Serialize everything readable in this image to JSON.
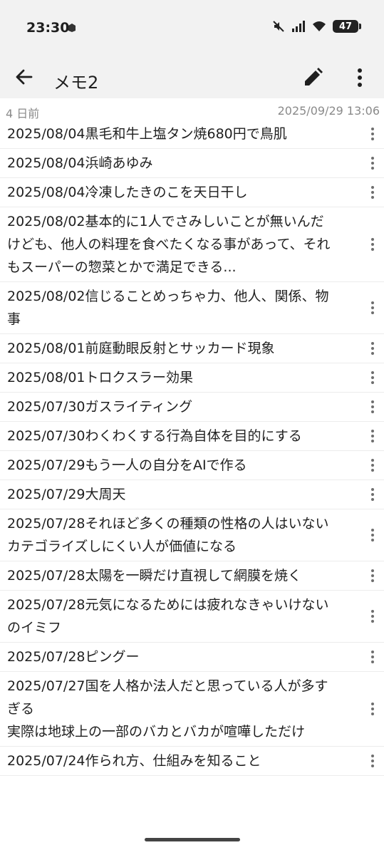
{
  "status": {
    "time": "23:30",
    "battery": "47"
  },
  "appbar": {
    "title": "メモ2"
  },
  "meta": {
    "relative": "4 日前",
    "timestamp": "2025/09/29 13:06"
  },
  "items": [
    {
      "text": "2025/08/04黒毛和牛上塩タン焼680円で鳥肌"
    },
    {
      "text": "2025/08/04浜崎あゆみ"
    },
    {
      "text": "2025/08/04冷凍したきのこを天日干し"
    },
    {
      "text": "2025/08/02基本的に1人でさみしいことが無いんだけども、他人の料理を食べたくなる事があって、それもスーパーの惣菜とかで満足できる..."
    },
    {
      "text": "2025/08/02信じることめっちゃ力、他人、関係、物事"
    },
    {
      "text": "2025/08/01前庭動眼反射とサッカード現象"
    },
    {
      "text": "2025/08/01トロクスラー効果"
    },
    {
      "text": "2025/07/30ガスライティング"
    },
    {
      "text": "2025/07/30わくわくする行為自体を目的にする"
    },
    {
      "text": "2025/07/29もう一人の自分をAIで作る"
    },
    {
      "text": "2025/07/29大周天"
    },
    {
      "text": "2025/07/28それほど多くの種類の性格の人はいない\nカテゴライズしにくい人が価値になる"
    },
    {
      "text": "2025/07/28太陽を一瞬だけ直視して網膜を焼く"
    },
    {
      "text": "2025/07/28元気になるためには疲れなきゃいけないのイミフ"
    },
    {
      "text": "2025/07/28ピングー"
    },
    {
      "text": "2025/07/27国を人格か法人だと思っている人が多すぎる\n実際は地球上の一部のバカとバカが喧嘩しただけ"
    },
    {
      "text": "2025/07/24作られ方、仕組みを知ること"
    }
  ]
}
